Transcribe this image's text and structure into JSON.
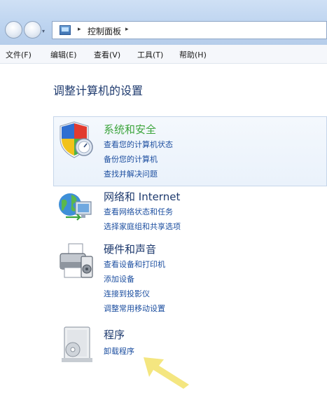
{
  "address_bar": {
    "path": "控制面板",
    "sep1": "▸",
    "sep2": "▸",
    "drop": "▾"
  },
  "menu": {
    "items": [
      "文件(F)",
      "编辑(E)",
      "查看(V)",
      "工具(T)",
      "帮助(H)"
    ]
  },
  "page_title": "调整计算机的设置",
  "categories": [
    {
      "title": "系统和安全",
      "links": [
        "查看您的计算机状态",
        "备份您的计算机",
        "查找并解决问题"
      ]
    },
    {
      "title": "网络和 Internet",
      "links": [
        "查看网络状态和任务",
        "选择家庭组和共享选项"
      ]
    },
    {
      "title": "硬件和声音",
      "links": [
        "查看设备和打印机",
        "添加设备",
        "连接到投影仪",
        "调整常用移动设置"
      ]
    },
    {
      "title": "程序",
      "links": [
        "卸载程序"
      ]
    }
  ],
  "colors": {
    "link": "#1d4fa0",
    "heading": "#1e3a6e",
    "hover_title": "#3da53d",
    "arrow": "#f2e26a"
  }
}
